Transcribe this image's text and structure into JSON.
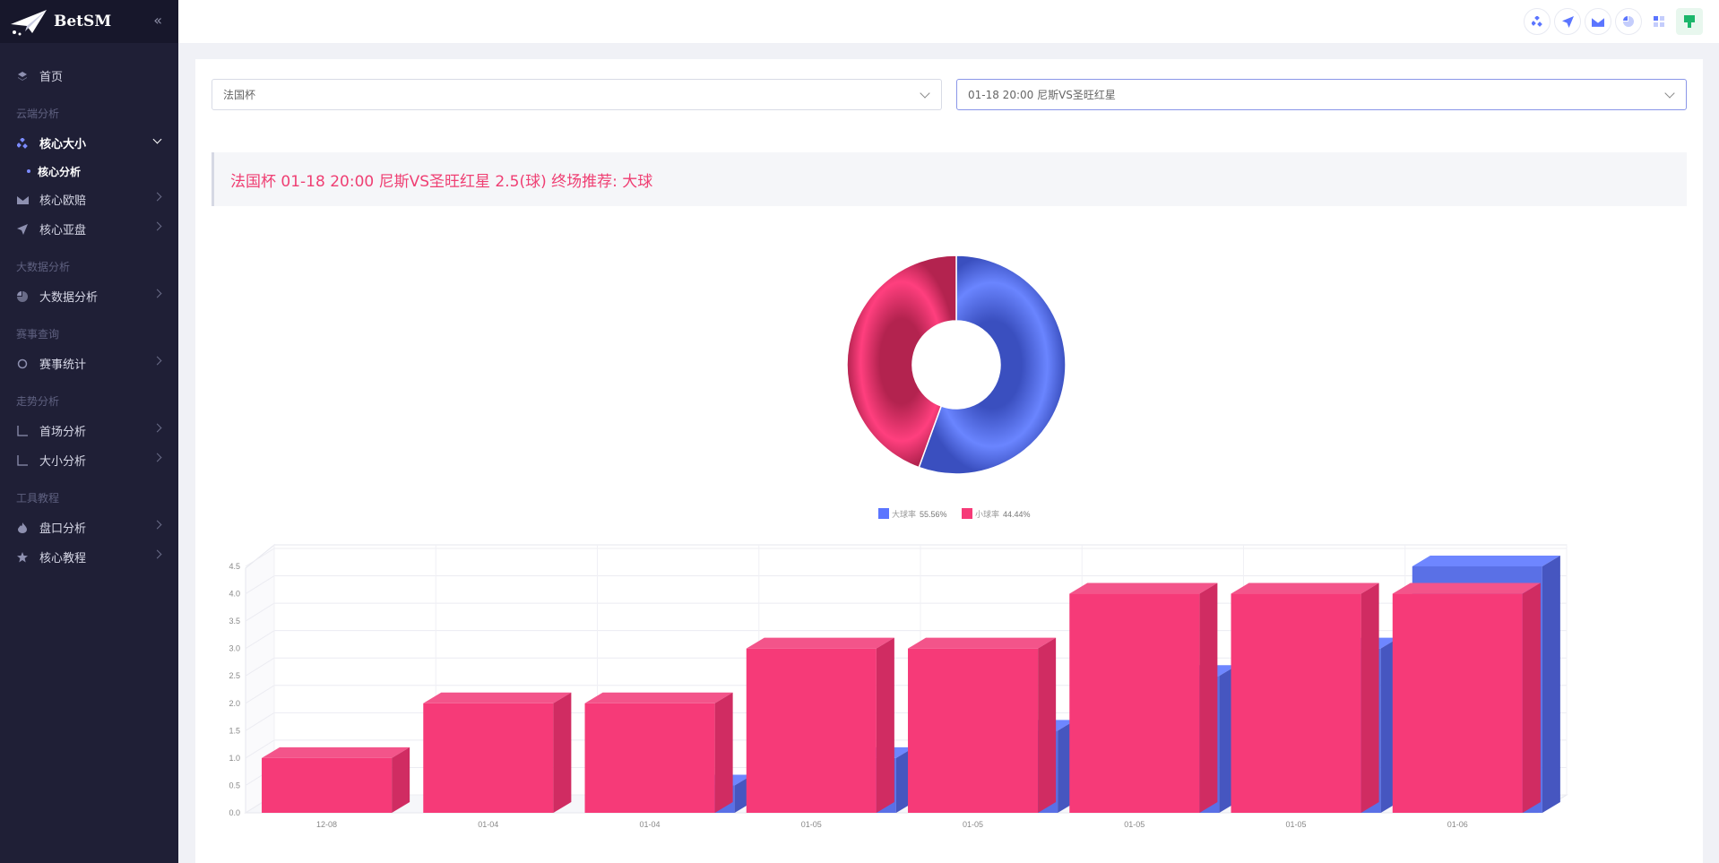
{
  "app": {
    "brand": "BetSM"
  },
  "sidebar": {
    "home": "首页",
    "groups": [
      {
        "title": "云端分析",
        "items": [
          {
            "label": "核心大小",
            "icon": "dots-icon",
            "open": true,
            "subitems": [
              "核心分析"
            ]
          },
          {
            "label": "核心欧赔",
            "icon": "envelope-icon"
          },
          {
            "label": "核心亚盘",
            "icon": "paper-plane-icon"
          }
        ]
      },
      {
        "title": "大数据分析",
        "items": [
          {
            "label": "大数据分析",
            "icon": "pie-icon"
          }
        ]
      },
      {
        "title": "赛事查询",
        "items": [
          {
            "label": "赛事统计",
            "icon": "circle-icon"
          }
        ]
      },
      {
        "title": "走势分析",
        "items": [
          {
            "label": "首场分析",
            "icon": "line-chart-icon"
          },
          {
            "label": "大小分析",
            "icon": "line-chart-icon"
          }
        ]
      },
      {
        "title": "工具教程",
        "items": [
          {
            "label": "盘口分析",
            "icon": "flame-icon"
          },
          {
            "label": "核心教程",
            "icon": "star-icon"
          }
        ]
      }
    ]
  },
  "topbar": {
    "icons": [
      "dots-icon",
      "paper-plane-icon",
      "envelope-icon",
      "pie-icon",
      "grid-icon",
      "user-avatar-icon"
    ]
  },
  "filters": {
    "league": "法国杯",
    "match": "01-18 20:00 尼斯VS圣旺红星"
  },
  "headline": "法国杯 01-18 20:00 尼斯VS圣旺红星 2.5(球) 终场推荐: 大球",
  "colors": {
    "blue": "#5b75ff",
    "pink": "#f63a78"
  },
  "chart_data": [
    {
      "type": "pie",
      "donut": true,
      "labels": [
        "大球率",
        "小球率"
      ],
      "values": [
        55.56,
        44.44
      ],
      "value_labels": [
        "55.56%",
        "44.44%"
      ],
      "legend": "bottom-center"
    },
    {
      "type": "bar",
      "bar3d": true,
      "categories": [
        "12-08",
        "01-04",
        "01-04",
        "01-05",
        "01-05",
        "01-05",
        "01-05",
        "01-06"
      ],
      "series": [
        {
          "values": [
            0.0,
            0.0,
            0.5,
            1.0,
            1.5,
            2.5,
            3.0,
            4.5
          ]
        },
        {
          "values": [
            1.0,
            2.0,
            2.0,
            3.0,
            3.0,
            4.0,
            4.0,
            4.0
          ]
        }
      ],
      "yticks": [
        "0.0",
        "0.5",
        "1.0",
        "1.5",
        "2.0",
        "2.5",
        "3.0",
        "3.5",
        "4.0",
        "4.5"
      ],
      "ylim": [
        0,
        4.5
      ],
      "grid": true
    }
  ]
}
